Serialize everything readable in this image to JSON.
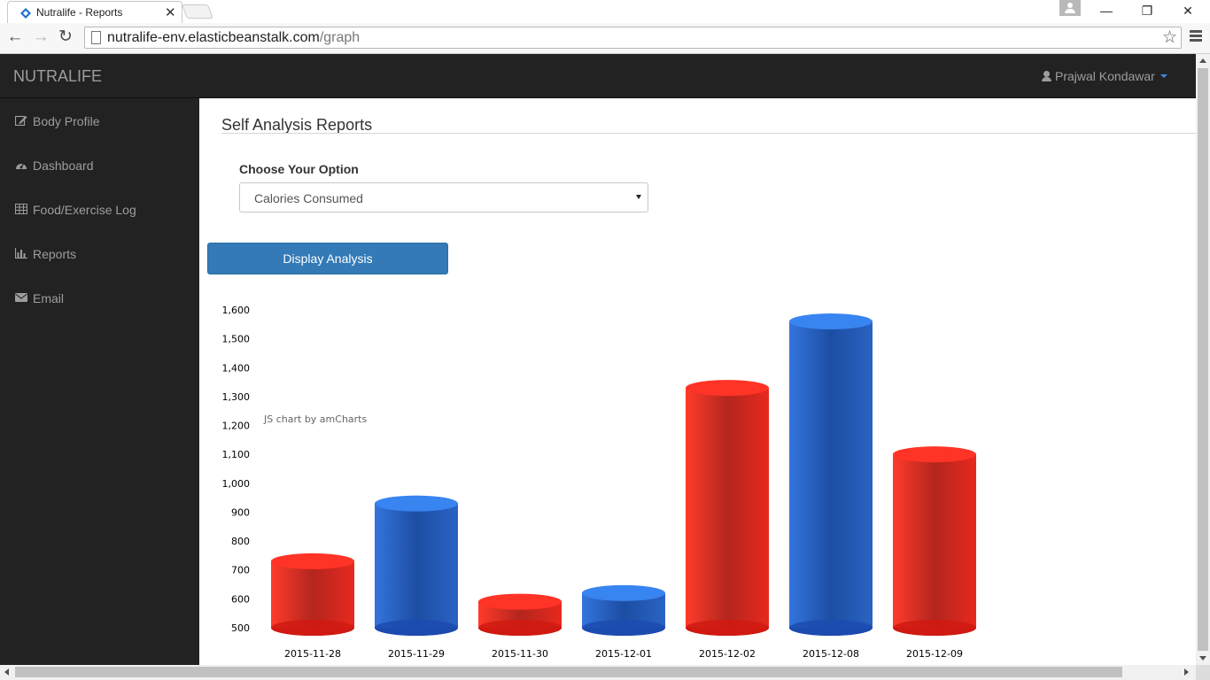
{
  "browser": {
    "tab_title": "Nutralife - Reports",
    "close_glyph": "✕",
    "url_host": "nutralife-env.elasticbeanstalk.com",
    "url_path": "/graph",
    "back_glyph": "←",
    "forward_glyph": "→",
    "reload_glyph": "↻",
    "star_glyph": "☆",
    "minimize_glyph": "—",
    "restore_glyph": "❐",
    "window_close_glyph": "✕"
  },
  "navbar": {
    "brand": "NUTRALIFE",
    "user_name": "Prajwal Kondawar"
  },
  "sidebar": {
    "items": [
      {
        "label": "Body Profile",
        "icon": "edit-icon"
      },
      {
        "label": "Dashboard",
        "icon": "dashboard-icon"
      },
      {
        "label": "Food/Exercise Log",
        "icon": "table-icon"
      },
      {
        "label": "Reports",
        "icon": "bar-chart-icon"
      },
      {
        "label": "Email",
        "icon": "envelope-icon"
      }
    ]
  },
  "main": {
    "title": "Self Analysis Reports",
    "option_label": "Choose Your Option",
    "selected_option": "Calories Consumed",
    "button_label": "Display Analysis"
  },
  "colors": {
    "red": "#e8281e",
    "blue": "#2a63c4",
    "navbar": "#222222",
    "button": "#337ab7"
  },
  "chart_data": {
    "type": "bar",
    "style": "3d-cylinder",
    "credit": "JS chart by amCharts",
    "categories": [
      "2015-11-28",
      "2015-11-29",
      "2015-11-30",
      "2015-12-01",
      "2015-12-02",
      "2015-12-08",
      "2015-12-09"
    ],
    "values": [
      730,
      930,
      590,
      620,
      1330,
      1560,
      1100
    ],
    "bar_colors": [
      "red",
      "blue",
      "red",
      "blue",
      "red",
      "blue",
      "red"
    ],
    "ylim": [
      500,
      1600
    ],
    "yticks": [
      "500",
      "600",
      "700",
      "800",
      "900",
      "1,000",
      "1,100",
      "1,200",
      "1,300",
      "1,400",
      "1,500",
      "1,600"
    ],
    "grid": false
  }
}
